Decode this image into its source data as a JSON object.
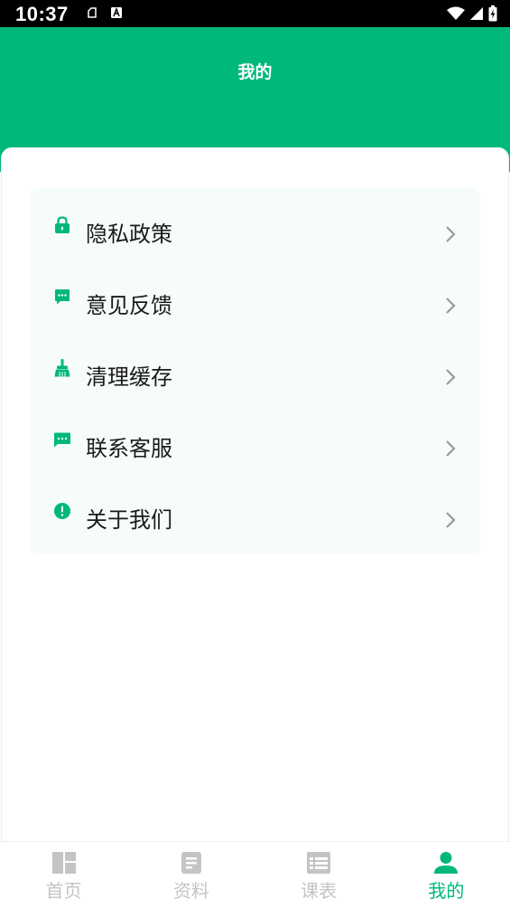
{
  "status_bar": {
    "time": "10:37"
  },
  "header": {
    "title": "我的"
  },
  "menu": {
    "items": [
      {
        "label": "隐私政策",
        "icon": "lock-icon"
      },
      {
        "label": "意见反馈",
        "icon": "chat-bubble-icon"
      },
      {
        "label": "清理缓存",
        "icon": "broom-icon"
      },
      {
        "label": "联系客服",
        "icon": "message-icon"
      },
      {
        "label": "关于我们",
        "icon": "info-alert-icon"
      }
    ]
  },
  "bottom_nav": {
    "tabs": [
      {
        "label": "首页",
        "icon": "dashboard-icon",
        "active": false
      },
      {
        "label": "资料",
        "icon": "document-icon",
        "active": false
      },
      {
        "label": "课表",
        "icon": "schedule-icon",
        "active": false
      },
      {
        "label": "我的",
        "icon": "person-icon",
        "active": true
      }
    ]
  },
  "colors": {
    "accent": "#00b87a",
    "card_background": "#f6fcf9",
    "inactive": "#c4c4c4"
  }
}
